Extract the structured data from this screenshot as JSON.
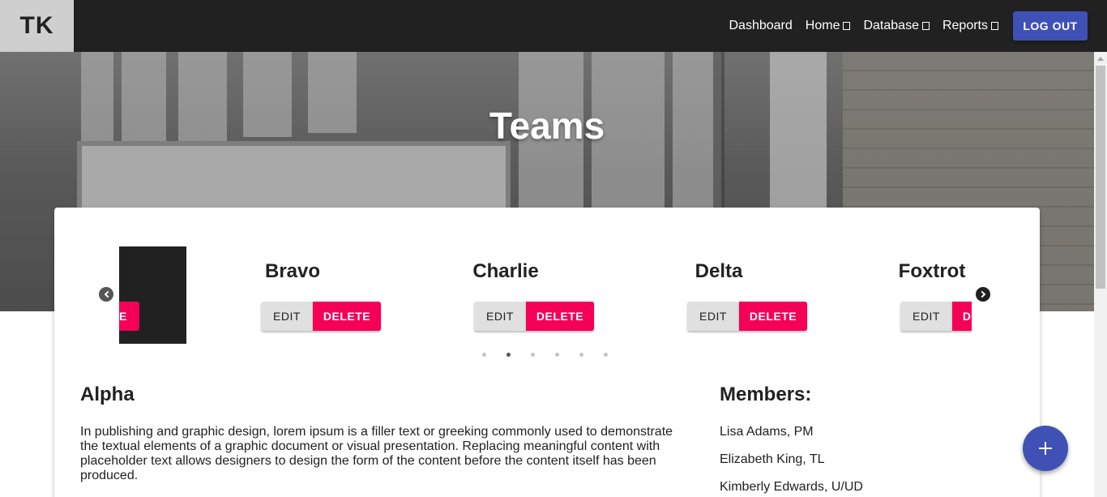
{
  "brand": {
    "logo_text": "TK"
  },
  "nav": {
    "items": [
      {
        "label": "Dashboard",
        "has_menu": false
      },
      {
        "label": "Home",
        "has_menu": true
      },
      {
        "label": "Database",
        "has_menu": true
      },
      {
        "label": "Reports",
        "has_menu": true
      }
    ],
    "logout_label": "LOG OUT"
  },
  "hero": {
    "title": "Teams"
  },
  "carousel": {
    "partial_slide_delete_fragment": "E",
    "slides": [
      {
        "name": "Bravo",
        "edit_label": "EDIT",
        "delete_label": "DELETE"
      },
      {
        "name": "Charlie",
        "edit_label": "EDIT",
        "delete_label": "DELETE"
      },
      {
        "name": "Delta",
        "edit_label": "EDIT",
        "delete_label": "DELETE"
      },
      {
        "name": "Foxtrot",
        "edit_label": "EDIT",
        "delete_label": "DELETE"
      }
    ],
    "dot_count": 6,
    "active_dot_index": 1,
    "prev_icon": "chevron-left-circle-icon",
    "next_icon": "chevron-right-circle-icon"
  },
  "detail": {
    "title": "Alpha",
    "description": "In publishing and graphic design, lorem ipsum is a filler text or greeking commonly used to demonstrate the textual elements of a graphic document or visual presentation. Replacing meaningful content with placeholder text allows designers to design the form of the content before the content itself has been produced.",
    "members_title": "Members:",
    "members": [
      "Lisa Adams, PM",
      "Elizabeth King, TL",
      "Kimberly Edwards, U/UD"
    ]
  },
  "fab": {
    "icon": "plus-icon"
  },
  "colors": {
    "topbar": "#212121",
    "primary": "#3f51b5",
    "delete": "#f50057",
    "edit": "#e0e0e0"
  }
}
